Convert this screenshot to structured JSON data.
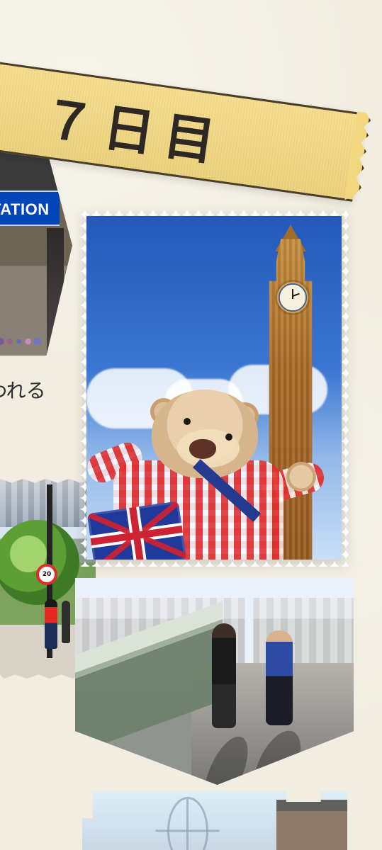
{
  "banner": {
    "title": "７日目"
  },
  "left_photo_top": {
    "sign_text": "TATION"
  },
  "text_fragment": "われる",
  "left_photo_bottom": {
    "speed_limit": "20"
  }
}
